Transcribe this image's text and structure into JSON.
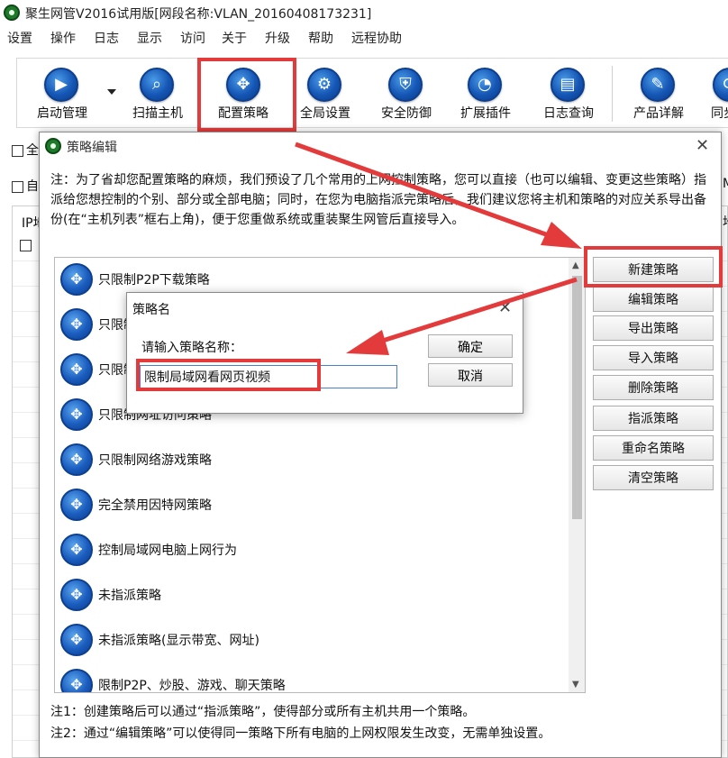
{
  "window": {
    "title": "聚生网管V2016试用版[网段名称:VLAN_20160408173231]"
  },
  "menu": [
    "设置",
    "操作",
    "日志",
    "显示",
    "访问",
    "关于",
    "升级",
    "帮助",
    "远程协助"
  ],
  "toolbar": {
    "buttons": [
      {
        "label": "启动管理",
        "icon": "play-icon"
      },
      {
        "label": "扫描主机",
        "icon": "search-icon"
      },
      {
        "label": "配置策略",
        "icon": "move-arrows-icon"
      },
      {
        "label": "全局设置",
        "icon": "gear-icon"
      },
      {
        "label": "安全防御",
        "icon": "shield-icon"
      },
      {
        "label": "扩展插件",
        "icon": "pie-chart-icon"
      },
      {
        "label": "日志查询",
        "icon": "log-book-icon"
      },
      {
        "label": "产品详解",
        "icon": "document-edit-icon"
      },
      {
        "label": "同步",
        "icon": "sync-icon"
      }
    ]
  },
  "main": {
    "checkbox1_label": "全",
    "checkbox2_label": "自",
    "column_header": "IP地",
    "right_fragment_1": "地",
    "right_fragment_2": "M"
  },
  "dialog": {
    "title": "策略编辑",
    "note": "注：为了省却您配置策略的麻烦，我们预设了几个常用的上网控制策略，您可以直接（也可以编辑、变更这些策略）指派给您想控制的个别、部分或全部电脑；同时，在您为电脑指派完策略后，我们建议您将主机和策略的对应关系导出备份(在“主机列表”框右上角)，便于您重做系统或重装聚生网管后直接导入。",
    "strategies": [
      "只限制P2P下载策略",
      "只限制",
      "只限制",
      "只限制网址访问策略",
      "只限制网络游戏策略",
      "完全禁用因特网策略",
      "控制局域网电脑上网行为",
      "未指派策略",
      "未指派策略(显示带宽、网址)",
      "限制P2P、炒股、游戏、聊天策略"
    ],
    "side_buttons": [
      "新建策略",
      "编辑策略",
      "导出策略",
      "导入策略",
      "删除策略",
      "指派策略",
      "重命名策略",
      "清空策略"
    ],
    "footnote1": "注1：创建策略后可以通过“指派策略”，使得部分或所有主机共用一个策略。",
    "footnote2": "注2：通过“编辑策略”可以使得同一策略下所有电脑的上网权限发生改变，无需单独设置。"
  },
  "popup": {
    "title": "策略名",
    "prompt": "请输入策略名称：",
    "input_value": "限制局域网看网页视频",
    "ok_label": "确定",
    "cancel_label": "取消"
  },
  "colors": {
    "highlight_red": "#e33b3b",
    "icon_blue": "#1556b5"
  }
}
